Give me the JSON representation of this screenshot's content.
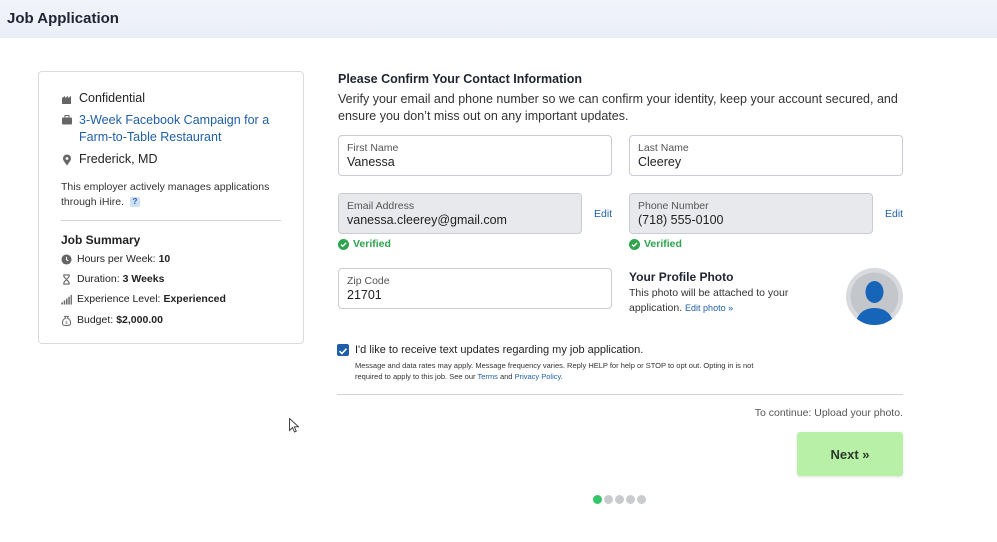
{
  "header": {
    "title": "Job Application"
  },
  "job": {
    "company": "Confidential",
    "title": "3-Week Facebook Campaign for a Farm-to-Table Restaurant",
    "location": "Frederick, MD",
    "management_note": "This employer actively manages applications through iHire.",
    "help_badge": "?"
  },
  "summary": {
    "title": "Job Summary",
    "items": [
      {
        "label": "Hours per Week:",
        "value": "10",
        "icon": "clock-icon"
      },
      {
        "label": "Duration:",
        "value": "3 Weeks",
        "icon": "hourglass-icon"
      },
      {
        "label": "Experience Level:",
        "value": "Experienced",
        "icon": "signal-bars-icon"
      },
      {
        "label": "Budget:",
        "value": "$2,000.00",
        "icon": "money-bag-icon"
      }
    ]
  },
  "form": {
    "heading": "Please Confirm Your Contact Information",
    "intro": "Verify your email and phone number so we can confirm your identity, keep your account secured, and ensure you don’t miss out on any important updates.",
    "first_name": {
      "label": "First Name",
      "value": "Vanessa"
    },
    "last_name": {
      "label": "Last Name",
      "value": "Cleerey"
    },
    "email": {
      "label": "Email Address",
      "value": "vanessa.cleerey@gmail.com",
      "edit": "Edit",
      "status": "Verified"
    },
    "phone": {
      "label": "Phone Number",
      "value": "(718) 555-0100",
      "edit": "Edit",
      "status": "Verified"
    },
    "zip": {
      "label": "Zip Code",
      "value": "21701"
    },
    "photo": {
      "title": "Your Profile Photo",
      "desc": "This photo will be attached to your application.",
      "edit_link": "Edit photo »"
    },
    "text_updates": {
      "checked": true,
      "label": "I'd like to receive text updates regarding my job application.",
      "fine_print": "Message and data rates may apply. Message frequency varies. Reply HELP for help or STOP to opt out. Opting in is not required to apply to this job. See our",
      "terms": "Terms",
      "and": "and",
      "privacy": "Privacy Policy",
      "period": "."
    },
    "continue_note": "To continue: Upload your photo.",
    "next_label": "Next »"
  },
  "progress": {
    "steps": 5,
    "current": 1
  },
  "colors": {
    "link": "#1f5fa8",
    "verified": "#2ea44f",
    "next_button": "#b9f0a8",
    "active_dot": "#34c46a"
  }
}
